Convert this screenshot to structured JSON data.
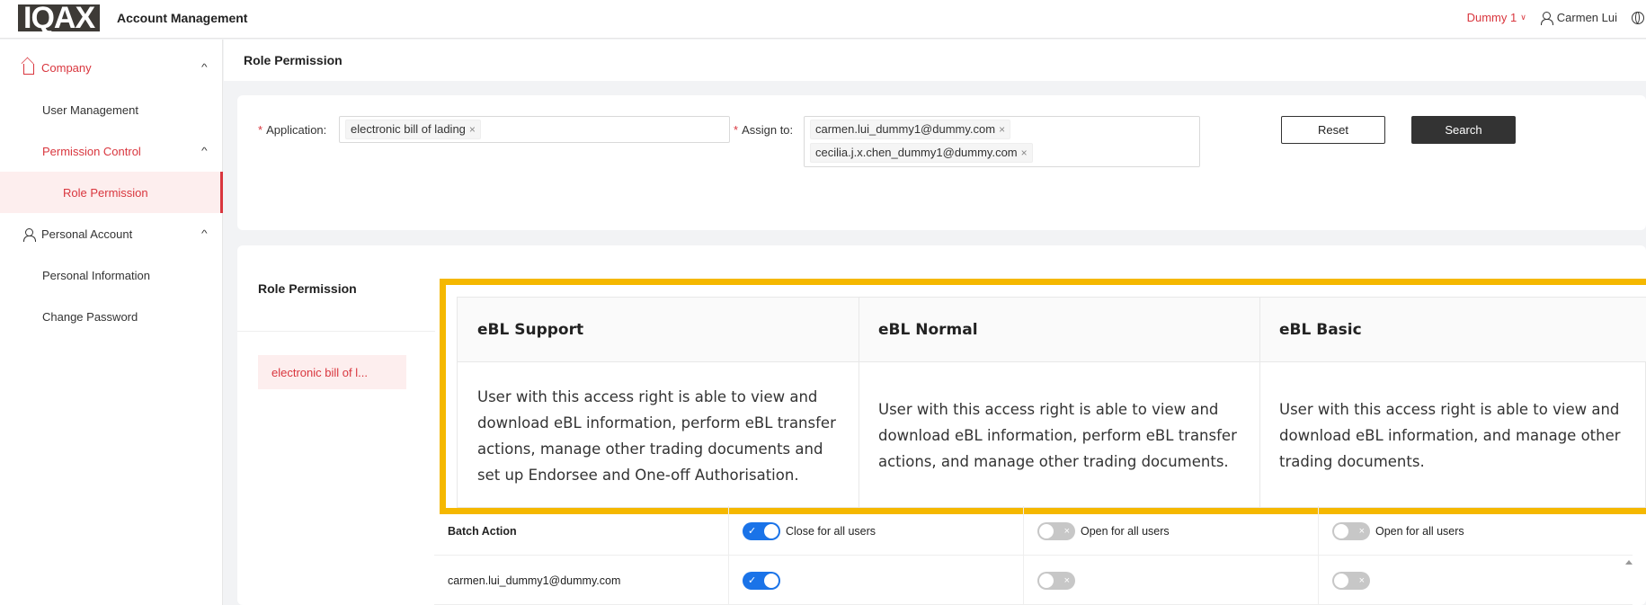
{
  "header": {
    "logo_text": "IQAX",
    "app_title": "Account Management",
    "org": "Dummy 1",
    "user": "Carmen Lui"
  },
  "sidebar": {
    "company": "Company",
    "user_management": "User Management",
    "permission_control": "Permission Control",
    "role_permission": "Role Permission",
    "personal_account": "Personal Account",
    "personal_information": "Personal Information",
    "change_password": "Change Password"
  },
  "page": {
    "title": "Role Permission"
  },
  "filters": {
    "application_label": "Application:",
    "application_tags": [
      "electronic bill of lading"
    ],
    "assign_label": "Assign to:",
    "assign_tags": [
      "carmen.lui_dummy1@dummy.com",
      "cecilia.j.x.chen_dummy1@dummy.com"
    ],
    "reset": "Reset",
    "search": "Search"
  },
  "role_permission": {
    "title": "Role Permission",
    "application_chip": "electronic bill of l...",
    "roles": [
      {
        "name": "eBL Support",
        "description": "User with this access right is able to view and download eBL information, perform eBL transfer actions, manage other trading documents and set up Endorsee and One-off Authorisation."
      },
      {
        "name": "eBL Normal",
        "description": "User with this access right is able to view and download eBL information, perform eBL transfer actions, and manage other trading documents."
      },
      {
        "name": "eBL Basic",
        "description": "User with this access right is able to view and download eBL information, and manage other trading documents."
      }
    ],
    "batch_action_label": "Batch Action",
    "batch": [
      {
        "label": "Close for all users",
        "on": true
      },
      {
        "label": "Open for all users",
        "on": false
      },
      {
        "label": "Open for all users",
        "on": false
      }
    ],
    "users": [
      {
        "email": "carmen.lui_dummy1@dummy.com",
        "switches": [
          true,
          false,
          false
        ]
      }
    ]
  }
}
